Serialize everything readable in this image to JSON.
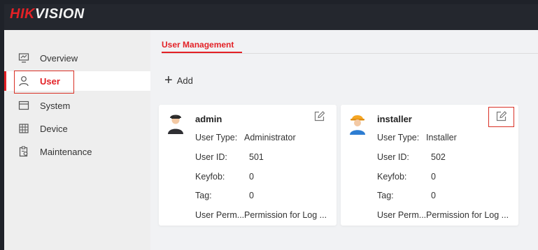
{
  "brand": {
    "logo_part1": "HIK",
    "logo_part2": "VISION"
  },
  "sidebar": {
    "items": [
      {
        "label": "Overview",
        "icon": "monitor-icon"
      },
      {
        "label": "User",
        "icon": "user-icon",
        "active": true
      },
      {
        "label": "System",
        "icon": "window-icon"
      },
      {
        "label": "Device",
        "icon": "device-grid-icon"
      },
      {
        "label": "Maintenance",
        "icon": "maintenance-icon"
      }
    ]
  },
  "main": {
    "tab_label": "User Management",
    "add_label": "Add",
    "users": [
      {
        "name": "admin",
        "avatar": "admin-avatar-icon",
        "fields": [
          {
            "key": "User Type:",
            "value": "Administrator"
          },
          {
            "key": "User ID:",
            "value": "501"
          },
          {
            "key": "Keyfob:",
            "value": "0"
          },
          {
            "key": "Tag:",
            "value": "0"
          },
          {
            "key": "User Perm...",
            "value": "Permission for Log ..."
          }
        ]
      },
      {
        "name": "installer",
        "avatar": "installer-avatar-icon",
        "fields": [
          {
            "key": "User Type:",
            "value": "Installer"
          },
          {
            "key": "User ID:",
            "value": "502"
          },
          {
            "key": "Keyfob:",
            "value": "0"
          },
          {
            "key": "Tag:",
            "value": "0"
          },
          {
            "key": "User Perm...",
            "value": "Permission for Log ..."
          }
        ]
      }
    ]
  },
  "colors": {
    "accent": "#e32126",
    "topbar": "#24272e",
    "sidebar": "#eeeeee",
    "highlight_box": "#d93025"
  }
}
